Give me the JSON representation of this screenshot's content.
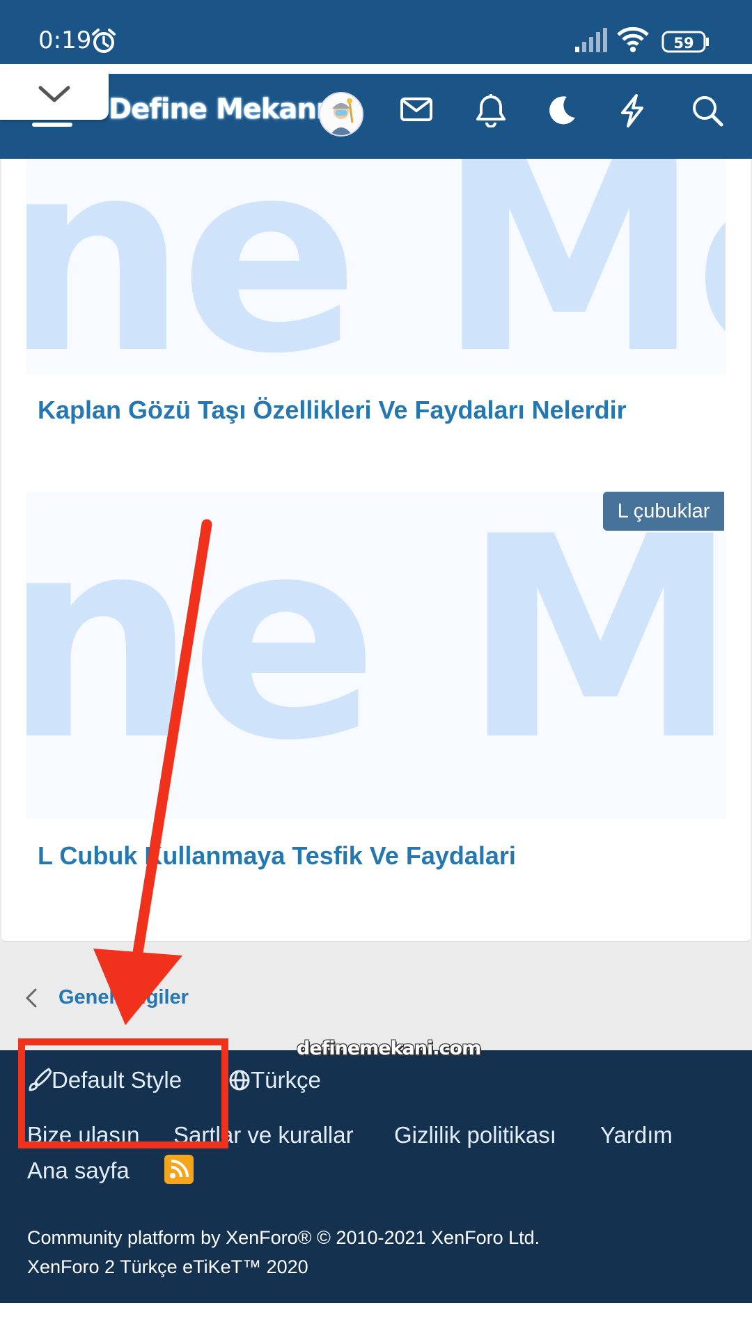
{
  "status_bar": {
    "time": "0:19",
    "battery": "59"
  },
  "header": {
    "logo": "Define Mekanı"
  },
  "posts": [
    {
      "title": "Kaplan Gözü Taşı Özellikleri Ve Faydaları Nelerdir"
    },
    {
      "prefix": "L çubuklar",
      "title": "L Cubuk Kullanmaya Tesfik Ve Faydalari"
    }
  ],
  "breadcrumb": {
    "label": "Genel Bilgiler"
  },
  "watermark": "definemekani.com",
  "footer": {
    "style_chooser": "Default Style",
    "language": "Türkçe",
    "links": [
      "Bize ulasın",
      "Sartlar ve kurallar",
      "Gizlilik politikası",
      "Yardım"
    ],
    "home": "Ana sayfa",
    "copyright_line1": "Community platform by XenForo® © 2010-2021 XenForo Ltd.",
    "copyright_line2": "XenForo 2 Türkçe eTiKeT™ 2020"
  },
  "colors": {
    "header_bg": "#1b5486",
    "footer_bg": "#14324f",
    "link": "#2577b1",
    "annotation": "#f0321c",
    "rss": "#f4a51c"
  }
}
